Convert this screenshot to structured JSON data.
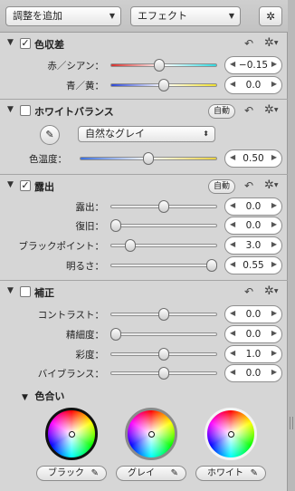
{
  "toolbar": {
    "add_adjustment": "調整を追加",
    "effects": "エフェクト",
    "wand_icon": "magic-wand"
  },
  "sections": {
    "color_aberration": {
      "title": "色収差",
      "checked": true,
      "rows": [
        {
          "label": "赤／シアン：",
          "value": "−0.15",
          "fill": 0.46
        },
        {
          "label": "青／黄：",
          "value": "0.0",
          "fill": 0.5
        }
      ]
    },
    "white_balance": {
      "title": "ホワイトバランス",
      "checked": false,
      "auto": "自動",
      "mode": "自然なグレイ",
      "rows": [
        {
          "label": "色温度：",
          "value": "0.50",
          "fill": 0.5
        }
      ]
    },
    "exposure": {
      "title": "露出",
      "checked": true,
      "auto": "自動",
      "rows": [
        {
          "label": "露出：",
          "value": "0.0",
          "fill": 0.5
        },
        {
          "label": "復旧：",
          "value": "0.0",
          "fill": 0.0
        },
        {
          "label": "ブラックポイント：",
          "value": "3.0",
          "fill": 0.15
        },
        {
          "label": "明るさ：",
          "value": "0.55",
          "fill": 1.0
        }
      ]
    },
    "correction": {
      "title": "補正",
      "checked": false,
      "rows": [
        {
          "label": "コントラスト：",
          "value": "0.0",
          "fill": 0.5
        },
        {
          "label": "精細度：",
          "value": "0.0",
          "fill": 0.0
        },
        {
          "label": "彩度：",
          "value": "1.0",
          "fill": 0.5
        },
        {
          "label": "バイブランス：",
          "value": "0.0",
          "fill": 0.5
        }
      ],
      "hue_title": "色合い",
      "wheels": [
        "ブラック",
        "グレイ",
        "ホワイト"
      ]
    }
  }
}
